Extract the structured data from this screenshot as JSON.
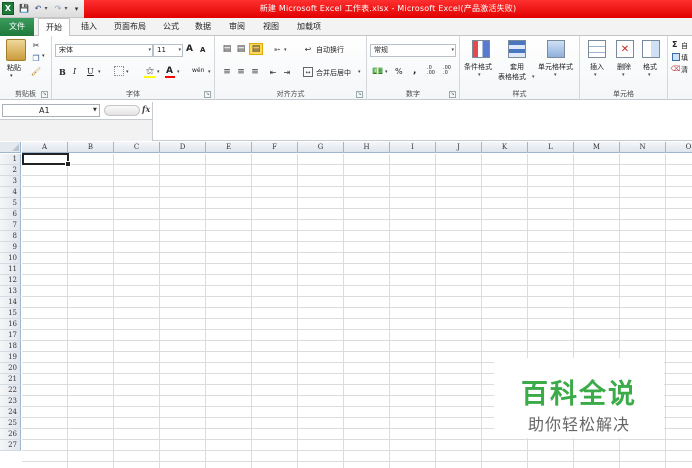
{
  "window": {
    "title": "新建 Microsoft Excel 工作表.xlsx  -  Microsoft Excel(产品激活失败)"
  },
  "quick_access": {
    "logo_letter": "X"
  },
  "tabs": [
    {
      "label": "文件"
    },
    {
      "label": "开始"
    },
    {
      "label": "插入"
    },
    {
      "label": "页面布局"
    },
    {
      "label": "公式"
    },
    {
      "label": "数据"
    },
    {
      "label": "审阅"
    },
    {
      "label": "视图"
    },
    {
      "label": "加载项"
    }
  ],
  "ribbon": {
    "clipboard": {
      "label": "剪贴板",
      "paste": "粘贴"
    },
    "font": {
      "label": "字体",
      "name": "宋体",
      "size": "11",
      "bold": "B",
      "italic": "I",
      "underline": "U",
      "grow": "A",
      "shrink": "A",
      "font_color": "A",
      "phonetic": "wén"
    },
    "alignment": {
      "label": "对齐方式",
      "wrap": "自动换行",
      "merge": "合并后居中"
    },
    "number": {
      "label": "数字",
      "format": "常规",
      "percent": "%",
      "comma": ",",
      "inc_dec": ".0 .00",
      "dec_dec": ".00 .0"
    },
    "styles": {
      "label": "样式",
      "conditional": "条件格式",
      "table_format_1": "套用",
      "table_format_2": "表格格式",
      "cell_styles": "单元格样式"
    },
    "cells": {
      "label": "单元格",
      "insert": "插入",
      "delete": "删除",
      "format": "格式"
    },
    "editing": {
      "sigma": "Σ",
      "sum": "自",
      "fill": "填",
      "clear": "清"
    }
  },
  "formula_bar": {
    "name_box": "A1",
    "fx": "fx",
    "value": ""
  },
  "columns": [
    "A",
    "B",
    "C",
    "D",
    "E",
    "F",
    "G",
    "H",
    "I",
    "J",
    "K",
    "L",
    "M",
    "N",
    "O"
  ],
  "rows": [
    "1",
    "2",
    "3",
    "4",
    "5",
    "6",
    "7",
    "8",
    "9",
    "10",
    "11",
    "12",
    "13",
    "14",
    "15",
    "16",
    "17",
    "18",
    "19",
    "20",
    "21",
    "22",
    "23",
    "24",
    "25",
    "26",
    "27"
  ],
  "watermark": {
    "title": "百科全说",
    "subtitle": "助你轻松解决"
  },
  "colors": {
    "title_red": "#e00000",
    "file_tab_green": "#1f7a3a",
    "watermark_green": "#3aab48"
  }
}
